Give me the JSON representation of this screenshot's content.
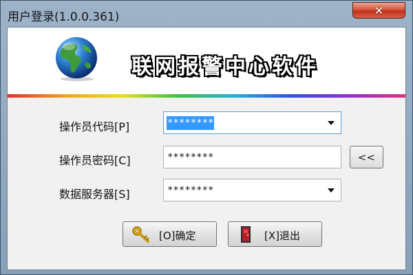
{
  "window": {
    "title": "用户登录(1.0.0.361)",
    "close_symbol": "✕"
  },
  "banner": {
    "logo_icon": "globe-icon",
    "title": "联网报警中心软件"
  },
  "form": {
    "operator_code": {
      "label": "操作员代码[P]",
      "value": "********"
    },
    "operator_password": {
      "label": "操作员密码[C]",
      "value": "********"
    },
    "data_server": {
      "label": "数据服务器[S]",
      "value": "********"
    },
    "collapse_button": "<<"
  },
  "buttons": {
    "ok": {
      "label": "[O]确定",
      "icon": "key-icon"
    },
    "exit": {
      "label": "[X]退出",
      "icon": "door-exit-icon"
    }
  },
  "colors": {
    "title_bar": "#9eb3c7",
    "close_button": "#c1301b",
    "selection": "#3399ff"
  }
}
